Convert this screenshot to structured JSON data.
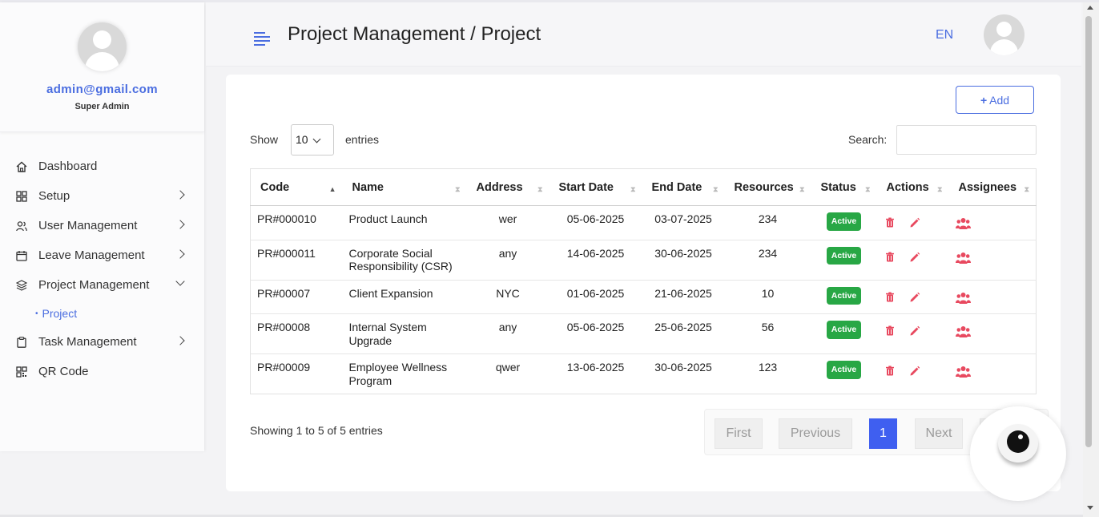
{
  "sidebar": {
    "email": "admin@gmail.com",
    "role": "Super Admin",
    "items": [
      {
        "label": "Dashboard",
        "icon": "home-icon"
      },
      {
        "label": "Setup",
        "icon": "grid-icon"
      },
      {
        "label": "User Management",
        "icon": "users-icon"
      },
      {
        "label": "Leave Management",
        "icon": "calendar-icon"
      },
      {
        "label": "Project Management",
        "icon": "layers-icon"
      },
      {
        "label": "Task Management",
        "icon": "clipboard-icon"
      },
      {
        "label": "QR Code",
        "icon": "qr-icon"
      }
    ],
    "sub_item": "Project"
  },
  "header": {
    "title": "Project Management / Project",
    "language": "EN"
  },
  "toolbar": {
    "add_label": "Add",
    "show_label": "Show",
    "entries_value": "10",
    "entries_label": "entries",
    "search_label": "Search:"
  },
  "table": {
    "headers": [
      "Code",
      "Name",
      "Address",
      "Start Date",
      "End Date",
      "Resources",
      "Status",
      "Actions",
      "Assignees"
    ],
    "rows": [
      {
        "code": "PR#000010",
        "name": "Product Launch",
        "address": "wer",
        "start": "05-06-2025",
        "end": "03-07-2025",
        "resources": "234",
        "status": "Active"
      },
      {
        "code": "PR#000011",
        "name": "Corporate Social Responsibility (CSR)",
        "address": "any",
        "start": "14-06-2025",
        "end": "30-06-2025",
        "resources": "234",
        "status": "Active"
      },
      {
        "code": "PR#00007",
        "name": "Client Expansion",
        "address": "NYC",
        "start": "01-06-2025",
        "end": "21-06-2025",
        "resources": "10",
        "status": "Active"
      },
      {
        "code": "PR#00008",
        "name": "Internal System Upgrade",
        "address": "any",
        "start": "05-06-2025",
        "end": "25-06-2025",
        "resources": "56",
        "status": "Active"
      },
      {
        "code": "PR#00009",
        "name": "Employee Wellness Program",
        "address": "qwer",
        "start": "13-06-2025",
        "end": "30-06-2025",
        "resources": "123",
        "status": "Active"
      }
    ]
  },
  "footer": {
    "showing": "Showing 1 to 5 of 5 entries",
    "pagination": {
      "first": "First",
      "previous": "Previous",
      "current": "1",
      "next": "Next",
      "last": "La"
    }
  },
  "colors": {
    "accent": "#4a6de0",
    "status_active": "#28a745",
    "action_red": "#e8495f",
    "page_current": "#3f5ff0"
  }
}
